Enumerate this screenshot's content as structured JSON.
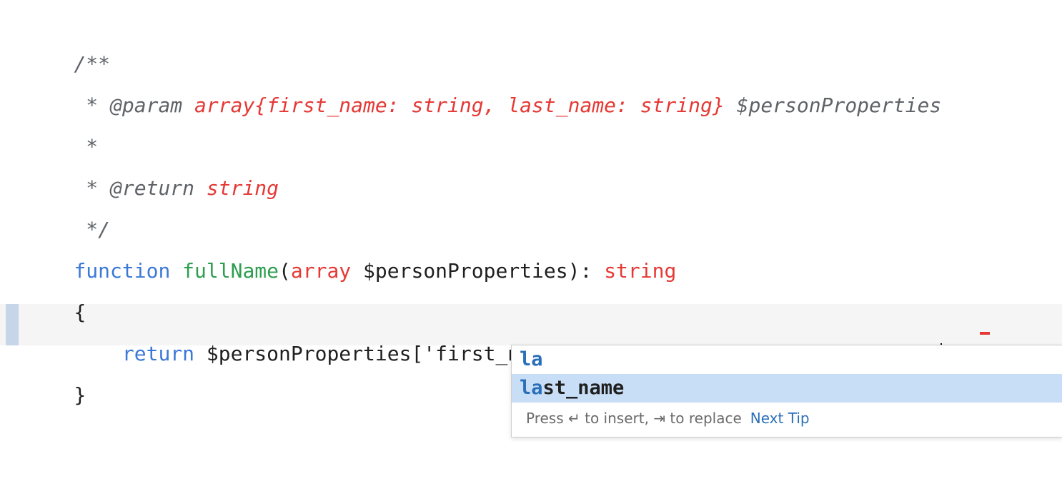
{
  "editor": {
    "lines": {
      "l1": {
        "text": "/**"
      },
      "l2": {
        "prefix": " * @param ",
        "type": "array{first_name: string, last_name: string}",
        "var": " $personProperties"
      },
      "l3": {
        "text": " *"
      },
      "l4": {
        "prefix": " * @return ",
        "type": "string"
      },
      "l5": {
        "text": " */"
      },
      "l6": {
        "kw": "function",
        "name": "fullName",
        "open": "(",
        "ptype": "array",
        "param": " $personProperties): ",
        "rtype": "string"
      },
      "l7": {
        "text": "{"
      },
      "l8": {
        "kw": "    return",
        "code_before_caret": " $personProperties['first_name'] . ' ' . $personProperties['la",
        "code_after_caret": "']"
      },
      "l9": {
        "text": "}"
      }
    }
  },
  "completion": {
    "items": [
      {
        "match": "la",
        "rest": ""
      },
      {
        "match": "la",
        "rest": "st_name"
      }
    ],
    "footer": {
      "hint_prefix": "Press ",
      "enter_glyph": "↵",
      "hint_middle": " to insert, ",
      "tab_glyph": "⇥",
      "hint_suffix": " to replace",
      "next_tip": "Next Tip"
    }
  },
  "colors": {
    "keyword": "#3b78d8",
    "function_name": "#2e9e4f",
    "type": "#e53935",
    "comment": "#5f6368",
    "selection": "#c8ddf6"
  }
}
